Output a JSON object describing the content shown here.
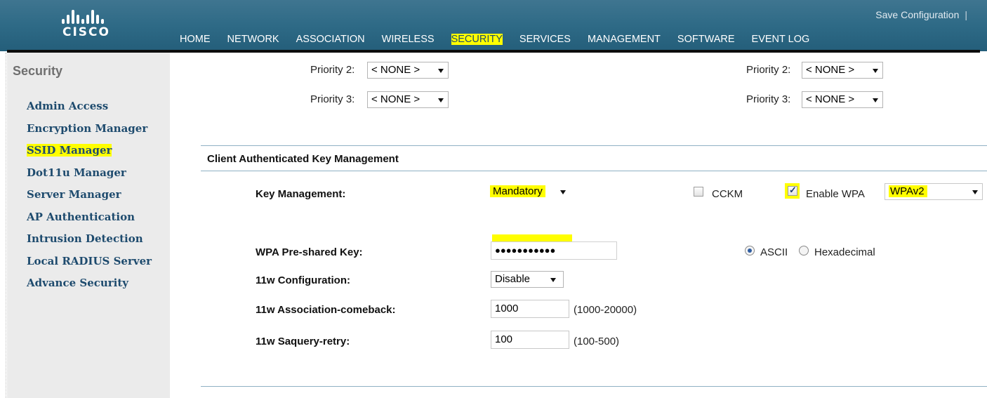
{
  "header": {
    "logo_text": "CISCO",
    "save_configuration": "Save Configuration",
    "separator": "|",
    "nav_tabs": [
      {
        "label": "HOME",
        "active": false
      },
      {
        "label": "NETWORK",
        "active": false
      },
      {
        "label": "ASSOCIATION",
        "active": false
      },
      {
        "label": "WIRELESS",
        "active": false
      },
      {
        "label": "SECURITY",
        "active": true
      },
      {
        "label": "SERVICES",
        "active": false
      },
      {
        "label": "MANAGEMENT",
        "active": false
      },
      {
        "label": "SOFTWARE",
        "active": false
      },
      {
        "label": "EVENT LOG",
        "active": false
      }
    ]
  },
  "sidebar": {
    "title": "Security",
    "items": [
      {
        "label": "Admin Access"
      },
      {
        "label": "Encryption Manager"
      },
      {
        "label": "SSID Manager",
        "highlighted": true
      },
      {
        "label": "Dot11u Manager"
      },
      {
        "label": "Server Manager"
      },
      {
        "label": "AP Authentication"
      },
      {
        "label": "Intrusion Detection"
      },
      {
        "label": "Local RADIUS Server"
      },
      {
        "label": "Advance Security"
      }
    ]
  },
  "priorities": {
    "left": [
      {
        "label": "Priority 2:",
        "value": "< NONE >"
      },
      {
        "label": "Priority 3:",
        "value": "< NONE >"
      }
    ],
    "right": [
      {
        "label": "Priority 2:",
        "value": "< NONE >"
      },
      {
        "label": "Priority 3:",
        "value": "< NONE >"
      }
    ]
  },
  "key_mgmt_section": {
    "title": "Client Authenticated Key Management",
    "key_management_label": "Key Management:",
    "key_management_value": "Mandatory",
    "cckm_label": "CCKM",
    "cckm_checked": false,
    "enable_wpa_label": "Enable WPA",
    "enable_wpa_checked": true,
    "wpa_version": "WPAv2",
    "psk_label": "WPA Pre-shared Key:",
    "psk_value": "●●●●●●●●●●●",
    "ascii_label": "ASCII",
    "hex_label": "Hexadecimal",
    "ascii_selected": true,
    "w11_config_label": "11w Configuration:",
    "w11_config_value": "Disable",
    "w11_comeback_label": "11w Association-comeback:",
    "w11_comeback_value": "1000",
    "w11_comeback_range": "(1000-20000)",
    "w11_saquery_label": "11w Saquery-retry:",
    "w11_saquery_value": "100",
    "w11_saquery_range": "(100-500)"
  },
  "colors": {
    "header_bg": "#2e6a86",
    "highlight": "#fffe00",
    "active_tab_underline": "#f39a1a",
    "sidebar_link": "#1e4b6e"
  }
}
